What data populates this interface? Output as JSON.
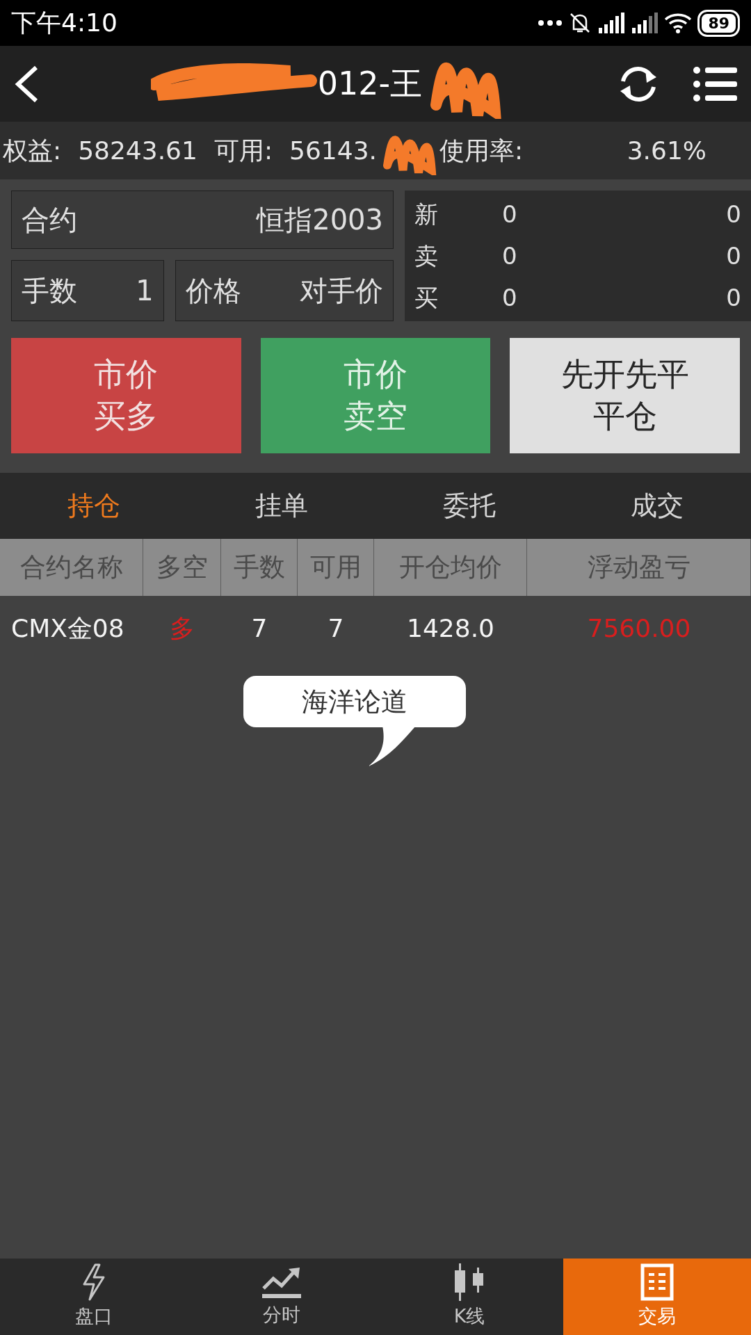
{
  "status_bar": {
    "time": "下午4:10",
    "battery": "89"
  },
  "header": {
    "title": "012-王"
  },
  "stats": [
    {
      "label": "权益:",
      "value": "58243.61"
    },
    {
      "label": "可用:",
      "value": "56143."
    },
    {
      "label": "使用率:",
      "value": "3.61%"
    }
  ],
  "order_form": {
    "contract": {
      "label": "合约",
      "value": "恒指2003"
    },
    "lots": {
      "label": "手数",
      "value": "1"
    },
    "price": {
      "label": "价格",
      "value": "对手价"
    }
  },
  "quote": [
    {
      "label": "新",
      "value_1": "0",
      "value_2": "0"
    },
    {
      "label": "卖",
      "value_1": "0",
      "value_2": "0"
    },
    {
      "label": "买",
      "value_1": "0",
      "value_2": "0"
    }
  ],
  "action_buttons": [
    {
      "kind": "buy",
      "lines": [
        "市价",
        "买多"
      ]
    },
    {
      "kind": "sell",
      "lines": [
        "市价",
        "卖空"
      ]
    },
    {
      "kind": "close",
      "lines": [
        "先开先平",
        "平仓"
      ]
    }
  ],
  "tabs": [
    {
      "label": "持仓",
      "selected": true
    },
    {
      "label": "挂单",
      "selected": false
    },
    {
      "label": "委托",
      "selected": false
    },
    {
      "label": "成交",
      "selected": false
    }
  ],
  "table": {
    "columns": [
      "合约名称",
      "多空",
      "手数",
      "可用",
      "开仓均价",
      "浮动盈亏"
    ],
    "rows": [
      [
        {
          "text": "CMX金08"
        },
        {
          "text": "多",
          "color": "#d81e1e"
        },
        {
          "text": "7"
        },
        {
          "text": "7"
        },
        {
          "text": "1428.0"
        },
        {
          "text": "7560.00",
          "color": "#d81e1e"
        }
      ]
    ]
  },
  "tooltip": {
    "text": "海洋论道"
  },
  "bottom_nav": [
    {
      "label": "盘口",
      "selected": false
    },
    {
      "label": "分时",
      "selected": false
    },
    {
      "label": "K线",
      "selected": false
    },
    {
      "label": "交易",
      "selected": true
    }
  ]
}
